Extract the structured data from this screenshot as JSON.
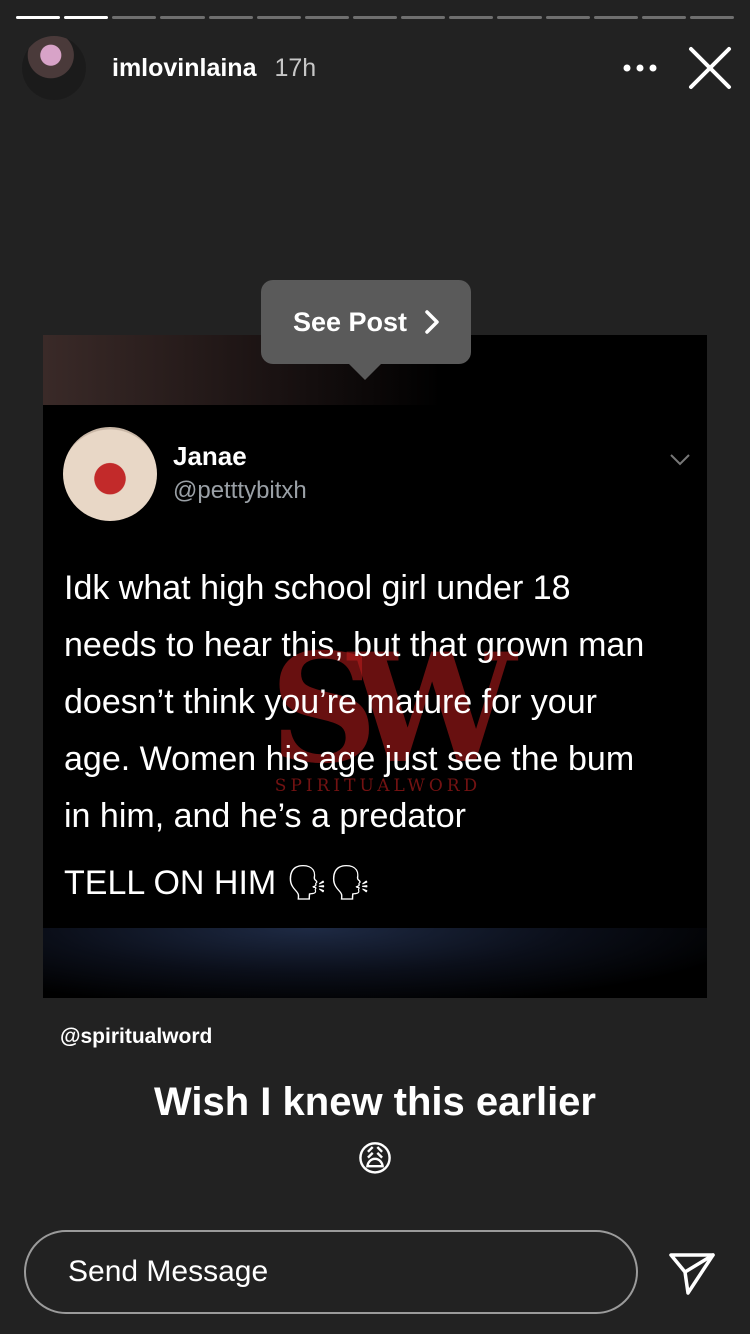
{
  "progress": {
    "total": 15,
    "current": 2
  },
  "header": {
    "username": "imlovinlaina",
    "time": "17h"
  },
  "see_post": {
    "label": "See Post"
  },
  "tweet": {
    "name": "Janae",
    "handle": "@petttybitxh",
    "text": "Idk what high school girl under 18\nneeds to hear this, but that grown man\ndoesn’t think you’re mature for your\nage. Women his age just see the bum\nin him, and he’s a predator",
    "tell": "TELL ON HIM 🗣🗣"
  },
  "watermark": {
    "logo": "SW",
    "text": "SPIRITUALWORD"
  },
  "credit": "@spiritualword",
  "caption": "Wish I knew this earlier",
  "emoji": "😩",
  "reply": {
    "placeholder": "Send Message"
  }
}
